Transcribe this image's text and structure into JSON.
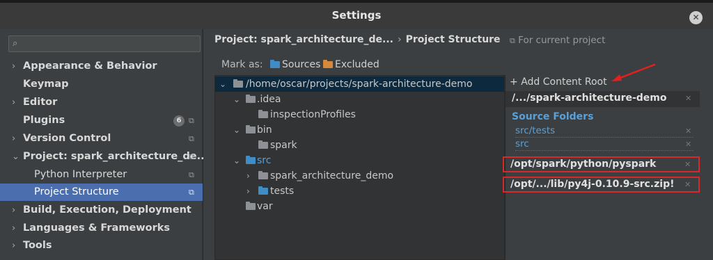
{
  "window": {
    "title": "Settings"
  },
  "search": {
    "placeholder": "",
    "value": ""
  },
  "sidebar": {
    "items": [
      {
        "label": "Appearance & Behavior"
      },
      {
        "label": "Keymap"
      },
      {
        "label": "Editor"
      },
      {
        "label": "Plugins",
        "badge": "6"
      },
      {
        "label": "Version Control"
      },
      {
        "label": "Project: spark_architecture_de..."
      },
      {
        "label": "Python Interpreter"
      },
      {
        "label": "Project Structure"
      },
      {
        "label": "Build, Execution, Deployment"
      },
      {
        "label": "Languages & Frameworks"
      },
      {
        "label": "Tools"
      }
    ]
  },
  "breadcrumb": {
    "project": "Project: spark_architecture_de...",
    "separator": "›",
    "page": "Project Structure"
  },
  "for_current_project": "For current project",
  "mark_as": {
    "label": "Mark as:",
    "sources": "Sources",
    "excluded": "Excluded"
  },
  "tree": [
    {
      "label": "/home/oscar/projects/spark-architecture-demo"
    },
    {
      "label": ".idea"
    },
    {
      "label": "inspectionProfiles"
    },
    {
      "label": "bin"
    },
    {
      "label": "spark"
    },
    {
      "label": "src"
    },
    {
      "label": "spark_architecture_demo"
    },
    {
      "label": "tests"
    },
    {
      "label": "var"
    }
  ],
  "roots": {
    "add_label": "Add Content Root",
    "content_root": "/.../spark-architecture-demo",
    "source_folders_title": "Source Folders",
    "source_folders": [
      "src/tests",
      "src"
    ],
    "external_roots": [
      "/opt/spark/python/pyspark",
      "/opt/.../lib/py4j-0.10.9-src.zip!"
    ]
  },
  "colors": {
    "accent_selection": "#4b6eaf",
    "source_blue": "#5aa0d8",
    "excluded_orange": "#d58a3b",
    "highlight_red": "#d42a2a"
  },
  "icons": {
    "close": "close-icon",
    "search": "search-icon",
    "folder": "folder-icon",
    "copy": "copy-icon",
    "arrow_annotation": "red-arrow-icon"
  }
}
